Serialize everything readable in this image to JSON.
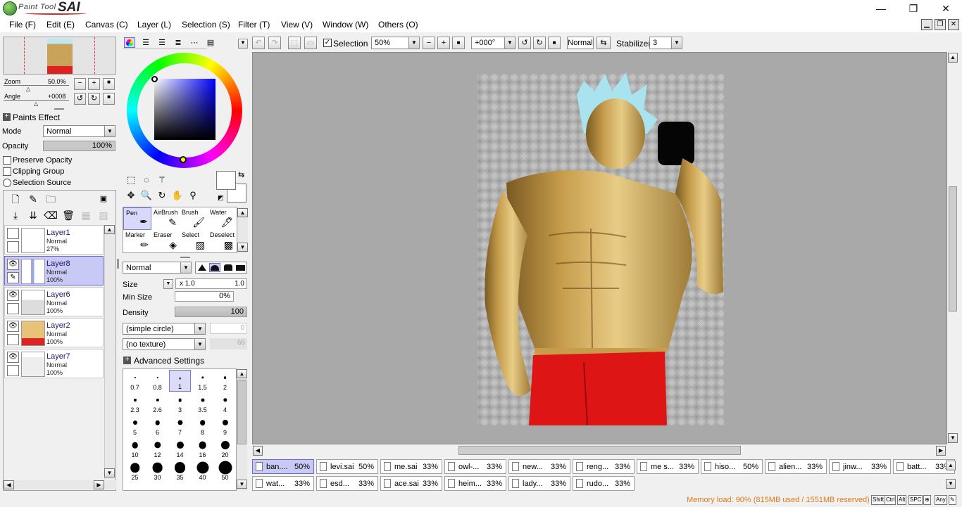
{
  "app": {
    "brand_small": "Paint Tool",
    "brand_big": "SAI"
  },
  "window_controls": {
    "minimize": "—",
    "maximize": "❐",
    "close": "✕"
  },
  "menu": [
    "File (F)",
    "Edit (E)",
    "Canvas (C)",
    "Layer (L)",
    "Selection (S)",
    "Filter (T)",
    "View (V)",
    "Window (W)",
    "Others (O)"
  ],
  "navigator": {
    "zoom_label": "Zoom",
    "zoom_value": "50.0%",
    "angle_label": "Angle",
    "angle_value": "+0008"
  },
  "paints_effect": {
    "label": "Paints Effect",
    "mode_label": "Mode",
    "mode_value": "Normal",
    "opacity_label": "Opacity",
    "opacity_value": "100%",
    "opacity_fraction": 1.0
  },
  "layer_options": {
    "preserve_opacity": "Preserve Opacity",
    "clipping_group": "Clipping Group",
    "selection_source": "Selection Source"
  },
  "layers": [
    {
      "name": "Layer1",
      "mode": "Normal",
      "opacity": "27%",
      "visible": false,
      "selected": false
    },
    {
      "name": "Layer8",
      "mode": "Normal",
      "opacity": "100%",
      "visible": true,
      "selected": true
    },
    {
      "name": "Layer6",
      "mode": "Normal",
      "opacity": "100%",
      "visible": true,
      "selected": false
    },
    {
      "name": "Layer2",
      "mode": "Normal",
      "opacity": "100%",
      "visible": true,
      "selected": false
    },
    {
      "name": "Layer7",
      "mode": "Normal",
      "opacity": "100%",
      "visible": true,
      "selected": false
    }
  ],
  "colors": {
    "hue_ring": "rainbow",
    "primary": "#1a1a8c",
    "secondary": "#ffffff",
    "accent_selected": "#c9c9f6",
    "canvas_bg": "#a9a9a9"
  },
  "tools": [
    {
      "name": "Pen",
      "icon": "pen-icon",
      "glyph": "✒",
      "selected": true
    },
    {
      "name": "AirBrush",
      "icon": "airbrush-icon",
      "glyph": "✎",
      "selected": false
    },
    {
      "name": "Brush",
      "icon": "brush-icon",
      "glyph": "🖌",
      "selected": false
    },
    {
      "name": "Water",
      "icon": "water-icon",
      "glyph": "🖋",
      "selected": false
    },
    {
      "name": "Marker",
      "icon": "marker-icon",
      "glyph": "✏",
      "selected": false
    },
    {
      "name": "Eraser",
      "icon": "eraser-icon",
      "glyph": "◈",
      "selected": false
    },
    {
      "name": "Select",
      "icon": "select-brush-icon",
      "glyph": "▨",
      "selected": false
    },
    {
      "name": "Deselect",
      "icon": "deselect-brush-icon",
      "glyph": "▩",
      "selected": false
    }
  ],
  "brush": {
    "blend_mode": "Normal",
    "size_label": "Size",
    "size_mult": "x 1.0",
    "size_value": "1.0",
    "min_size_label": "Min Size",
    "min_size_value": "0%",
    "density_label": "Density",
    "density_value": "100",
    "shape": "(simple circle)",
    "shape_value": "0",
    "texture": "(no texture)",
    "texture_value": "66",
    "advanced": "Advanced Settings"
  },
  "brush_sizes": [
    "0.7",
    "0.8",
    "1",
    "1.5",
    "2",
    "2.3",
    "2.6",
    "3",
    "3.5",
    "4",
    "5",
    "6",
    "7",
    "8",
    "9",
    "10",
    "12",
    "14",
    "16",
    "20",
    "25",
    "30",
    "35",
    "40",
    "50"
  ],
  "toolbar": {
    "selection_label": "Selection",
    "zoom": "50%",
    "rotation": "+000°",
    "mode": "Normal",
    "stabilizer_label": "Stabilizer",
    "stabilizer_value": "3"
  },
  "tabs_row1": [
    {
      "name": "ban....",
      "pct": "50%",
      "selected": true
    },
    {
      "name": "levi.sai",
      "pct": "50%"
    },
    {
      "name": "me.sai",
      "pct": "33%"
    },
    {
      "name": "owl-...",
      "pct": "33%"
    },
    {
      "name": "new...",
      "pct": "33%"
    },
    {
      "name": "reng...",
      "pct": "33%"
    },
    {
      "name": "me s...",
      "pct": "33%"
    },
    {
      "name": "hiso...",
      "pct": "50%"
    },
    {
      "name": "alien...",
      "pct": "33%"
    },
    {
      "name": "jinw...",
      "pct": "33%"
    },
    {
      "name": "batt...",
      "pct": "33%"
    }
  ],
  "tabs_row2": [
    {
      "name": "wat...",
      "pct": "33%"
    },
    {
      "name": "esd...",
      "pct": "33%"
    },
    {
      "name": "ace.sai",
      "pct": "33%"
    },
    {
      "name": "heim...",
      "pct": "33%"
    },
    {
      "name": "lady...",
      "pct": "33%"
    },
    {
      "name": "rudo...",
      "pct": "33%"
    }
  ],
  "status": {
    "memory": "Memory load: 90% (815MB used / 1551MB reserved)",
    "keys": [
      "Shift",
      "Ctrl",
      "Alt",
      "SPC",
      "⊕",
      "Any",
      "✎"
    ]
  }
}
